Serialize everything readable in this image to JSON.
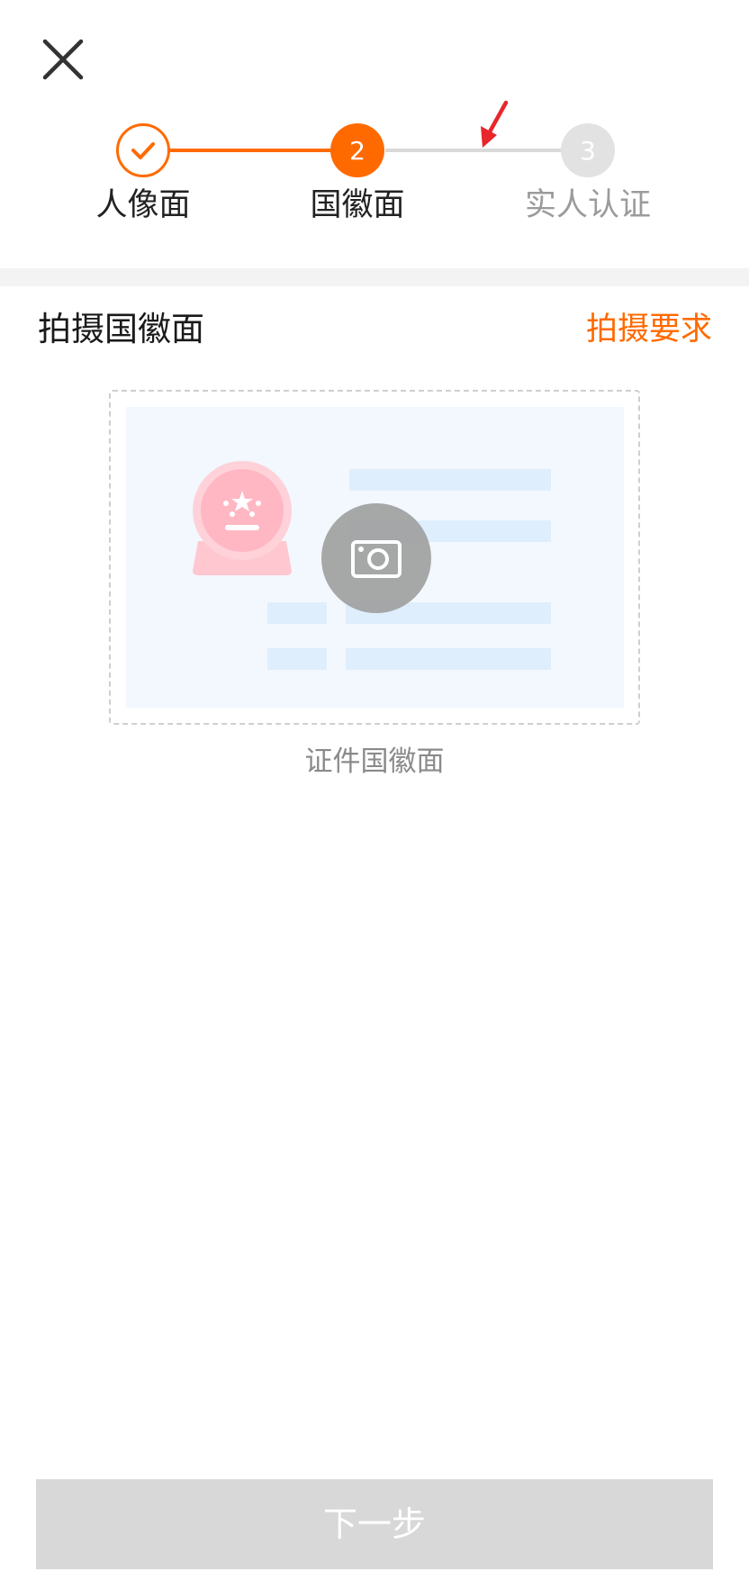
{
  "close_icon": "close-icon",
  "stepper": {
    "steps": [
      {
        "label": "人像面",
        "state": "done",
        "icon": "check-icon"
      },
      {
        "label": "国徽面",
        "state": "active",
        "number": "2"
      },
      {
        "label": "实人认证",
        "state": "todo",
        "number": "3"
      }
    ]
  },
  "section": {
    "title": "拍摄国徽面",
    "requirements_link": "拍摄要求"
  },
  "capture": {
    "caption": "证件国徽面",
    "camera_icon": "camera-icon",
    "illustration": "id-card-emblem-side-illustration"
  },
  "footer": {
    "next_label": "下一步"
  },
  "colors": {
    "accent": "#ff6a00",
    "inactive_step": "#e2e2e2",
    "disabled_button": "#d8d8d8",
    "annotation_arrow": "#e8262b"
  }
}
